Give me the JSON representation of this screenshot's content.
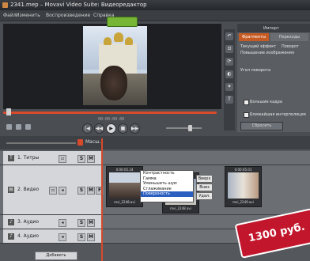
{
  "window": {
    "title": "2341.mep – Movavi Video Suite: Видеоредактор"
  },
  "menu": [
    "Файл",
    "Изменить",
    "Воспроизведение",
    "Справка"
  ],
  "player": {
    "timecode": "00:00:00.00"
  },
  "panel": {
    "tabs": [
      "Импорт",
      "Фрагменты",
      "Переходы"
    ],
    "rows": [
      "Текущий эффект",
      "Поворот",
      "Повышение изображения",
      "Угол поворота",
      "Большие кадра",
      "Ближайшая интерполяция",
      "Сбросить"
    ]
  },
  "timeline": {
    "zoom_label": "Масш.",
    "tracks": [
      {
        "name": "1. Титры",
        "icon": "T"
      },
      {
        "name": "2. Видео",
        "icon": "▤"
      },
      {
        "name": "3. Аудио",
        "icon": "♪"
      },
      {
        "name": "4. Аудио",
        "icon": "♪"
      }
    ],
    "clip_green_label": "",
    "clips": [
      {
        "time": "0:00:05.34",
        "file": "mvi_2248.avi"
      },
      {
        "time": "0:00:10.04",
        "file": "mvi_2248.avi"
      },
      {
        "time": "0:00:05.01",
        "file": "mvi_2249.avi"
      }
    ],
    "add_button": "Добавить"
  },
  "context_menu": {
    "items": [
      "Контрастность",
      "Гамма",
      "Уменьшить шум",
      "Сглаживание",
      "Поверхность"
    ],
    "selected_index": 4,
    "buttons": [
      "Вверх",
      "Вниз",
      "Удал."
    ]
  },
  "price_badge": "1300 руб."
}
